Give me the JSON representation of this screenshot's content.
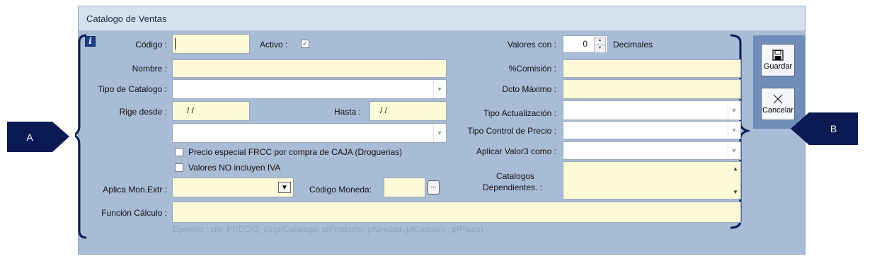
{
  "window": {
    "title": "Catalogo de Ventas"
  },
  "form": {
    "codigo": {
      "label": "Código :",
      "value": ""
    },
    "activo": {
      "label": "Activo :",
      "checked": true,
      "mark": "✓"
    },
    "nombre": {
      "label": "Nombre :",
      "value": ""
    },
    "tipo_catalogo": {
      "label": "Tipo de Catalogo :",
      "value": ""
    },
    "rige_desde": {
      "label": "Rige desde :",
      "value": "/ /"
    },
    "hasta": {
      "label": "Hasta :",
      "value": "/ /"
    },
    "extra_combo": {
      "value": ""
    },
    "precio_especial": {
      "label": "Precio especial FRCC por compra de CAJA (Droguerias)",
      "checked": false
    },
    "valores_no_iva": {
      "label": "Valores NO incluyen IVA",
      "checked": false
    },
    "aplica_mon_extr": {
      "label": "Aplica Mon.Extr :",
      "value": ""
    },
    "codigo_moneda": {
      "label": "Código Moneda:",
      "value": "",
      "button": "..."
    },
    "funcion_calculo": {
      "label": "Función Cálculo :",
      "value": "",
      "hint": "Ejemplo : cm_PRECIO_01(pfCatalogo, pfProducto, pfUnidad, pfCuotaIni , pfPlazo)"
    },
    "valores_con": {
      "label": "Valores con :",
      "value": "0",
      "suffix": "Decimales"
    },
    "comision": {
      "label": "%Comisión :",
      "value": ""
    },
    "dcto_maximo": {
      "label": "Dcto Máximo :",
      "value": ""
    },
    "tipo_actualizacion": {
      "label": "Tipo Actualización :",
      "value": ""
    },
    "tipo_control_precio": {
      "label": "Tipo Control de Precio :",
      "value": ""
    },
    "aplicar_valor3": {
      "label": "Aplicar Valor3 como :",
      "value": ""
    },
    "catalogos_dependientes": {
      "label_line1": "Catalogos",
      "label_line2": "Dependientes. :"
    }
  },
  "toolbar": {
    "guardar": "Guardar",
    "cancelar": "Cancelar"
  },
  "callouts": {
    "a": "A",
    "b": "B"
  },
  "icons": {
    "info": "i",
    "dropdown": "▼",
    "spin_up": "▲",
    "spin_down": "▼",
    "scroll_up": "▲",
    "scroll_down": "▼"
  },
  "colors": {
    "accent": "#0c1a54",
    "field_bg": "#fdfbd7",
    "panel_bg": "#a9bcd6"
  }
}
